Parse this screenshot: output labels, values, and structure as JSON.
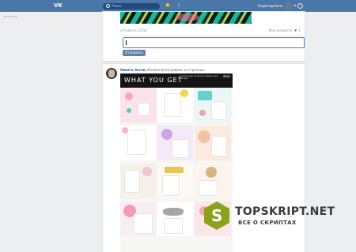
{
  "topbar": {
    "logo": "VK",
    "search_placeholder": "Поиск",
    "username": "Редактировать",
    "help": "?"
  },
  "leftnav": {
    "item": "Новости"
  },
  "post1": {
    "timestamp": "сегодня в 12:56",
    "likes_label": "Мне нравится",
    "likes_count": "1",
    "send_label": "Отправить"
  },
  "post2": {
    "author": "Никита Зотов",
    "action": "обновил фотографию на странице:",
    "banner_title": "WHAT YOU GET",
    "banner_subtitle": "20 PROFESSIONAL STYLED PHOTOGRAPHY PLACE YOUR PAINT",
    "banner_logo": "deal"
  },
  "watermark": {
    "title": "TOPSKRIPT.NET",
    "subtitle": "ВСЕ О СКРИПТАХ",
    "letter": "S"
  },
  "colors": {
    "topbar": "#4a76a8",
    "accent": "#5181b8",
    "watermark_green": "#8aa21e"
  }
}
